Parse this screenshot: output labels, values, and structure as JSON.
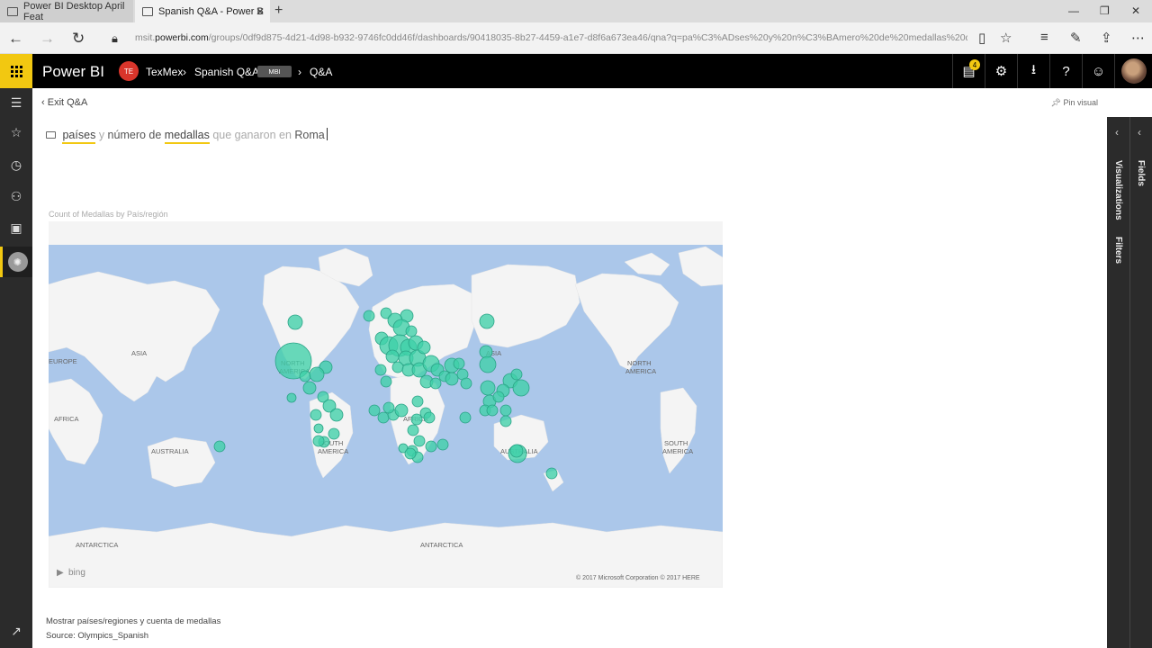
{
  "browser": {
    "tabs": [
      {
        "label": "Power BI Desktop April Feat"
      },
      {
        "label": "Spanish Q&A - Power B"
      }
    ],
    "url_prefix": "msit.",
    "url_host": "powerbi.com",
    "url_rest": "/groups/0df9d875-4d21-4d98-b932-9746fc0dd46f/dashboards/90418035-8b27-4459-a1e7-d8f6a673ea46/qna?q=pa%C3%ADses%20y%20n%C3%BAmero%20de%20medallas%20que%20ganaron"
  },
  "header": {
    "brand": "Power BI",
    "workspace_badge": "TE",
    "crumbs": [
      "TexMex",
      "Spanish Q&A",
      "Q&A"
    ],
    "tag": "MBI",
    "notification_count": "4"
  },
  "qna": {
    "exit_label": "Exit Q&A",
    "pin_label": "Pin visual",
    "question": [
      {
        "text": "países",
        "style": "kw"
      },
      {
        "text": "y",
        "style": "dim"
      },
      {
        "text": "número de",
        "style": "plain"
      },
      {
        "text": "medallas",
        "style": "kw"
      },
      {
        "text": "que ganaron en",
        "style": "dim"
      },
      {
        "text": "Roma",
        "style": "plain"
      }
    ],
    "footer_restatement": "Mostrar países/regiones y cuenta de medallas",
    "footer_source": "Source: Olympics_Spanish"
  },
  "map": {
    "title": "Count of Medallas by País/región",
    "labels": [
      "EUROPE",
      "ASIA",
      "NORTH AMERICA",
      "AFRICA",
      "AUSTRALIA",
      "SOUTH AMERICA",
      "AFRICA",
      "ASIA",
      "AUSTRALIA",
      "NORTH AMERICA",
      "SOUTH AMERICA",
      "ANTARCTICA",
      "ANTARCTICA"
    ],
    "attribution": "© 2017 Microsoft Corporation   © 2017 HERE",
    "provider": "bing",
    "bubble_color": "#3fcfa8",
    "ocean_color": "#abc7ea",
    "land_color": "#f4f4f4"
  },
  "panes": {
    "visualizations": "Visualizations",
    "filters": "Filters",
    "fields": "Fields"
  }
}
